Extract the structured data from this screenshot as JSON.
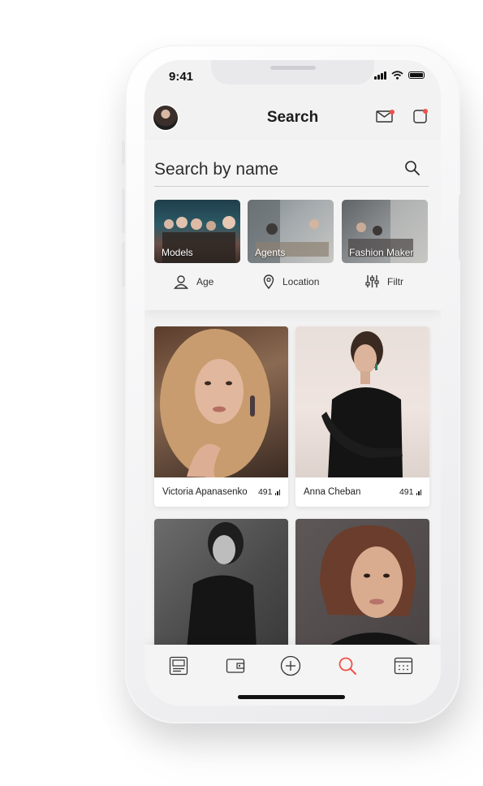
{
  "status": {
    "time": "9:41"
  },
  "header": {
    "title": "Search",
    "avatar_icon": "user-avatar",
    "mail_icon": "mail-icon",
    "notifications_icon": "notification-icon",
    "badge_color": "#f1504b"
  },
  "search": {
    "placeholder": "Search by name",
    "icon": "search-icon"
  },
  "categories": [
    {
      "label": "Models"
    },
    {
      "label": "Agents"
    },
    {
      "label": "Fashion Maker"
    }
  ],
  "filters": [
    {
      "label": "Age",
      "icon": "user-icon"
    },
    {
      "label": "Location",
      "icon": "location-pin-icon"
    },
    {
      "label": "Filtr",
      "icon": "sliders-icon"
    }
  ],
  "profiles": [
    {
      "name": "Victoria Apanasenko",
      "rating": "491"
    },
    {
      "name": "Anna Cheban",
      "rating": "491"
    },
    {
      "name": "",
      "rating": ""
    },
    {
      "name": "",
      "rating": ""
    }
  ],
  "tabbar": {
    "tabs": [
      "gallery-icon",
      "wallet-icon",
      "add-icon",
      "search-icon",
      "calendar-icon"
    ],
    "active_color": "#f1504b"
  }
}
